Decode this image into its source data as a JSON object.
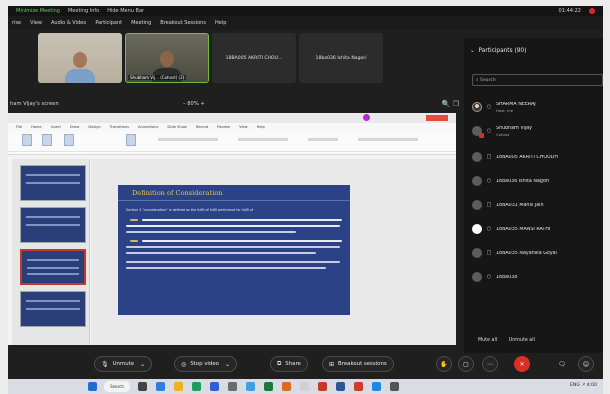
{
  "topbar": {
    "recording": "Minimize Meeting",
    "meeting_info": "Meeting Info",
    "hide_menu": "Hide Menu Bar",
    "time": "01:44:22"
  },
  "menubar": [
    "rise",
    "View",
    "Audio & Video",
    "Participant",
    "Meeting",
    "Breakout Sessions",
    "Help"
  ],
  "videos": [
    {
      "name": "",
      "type": "camera"
    },
    {
      "name": "Shubham Vij... (Cohost) (2)",
      "type": "camera"
    },
    {
      "name": "18BA005 AKRITI CHOU...",
      "type": "name"
    },
    {
      "name": "18ba036 Ishita Nagori",
      "type": "name"
    }
  ],
  "share": {
    "title": "ham Vijay's screen",
    "zoom": "–  80%  +"
  },
  "ppt": {
    "tabs": [
      "File",
      "Home",
      "Insert",
      "Draw",
      "Design",
      "Transitions",
      "Animations",
      "Slide Show",
      "Record",
      "Review",
      "View",
      "Help"
    ],
    "slide_title": "Definition of Consideration",
    "slide_intro": "Section 2 \"consideration\" is defined as the fulfil of fulfil performed for fulfil of"
  },
  "participants": {
    "header": "Participants (90)",
    "search_placeholder": "Search",
    "list": [
      {
        "name": "SHARMA NEERAJ",
        "sub": "Host, me",
        "icon": "○",
        "avatar": "img"
      },
      {
        "name": "Shubham Vijay",
        "sub": "Cohost",
        "icon": "○",
        "avatar": "badge"
      },
      {
        "name": "18BA005 AKRITI CHOUDH",
        "sub": "",
        "icon": "□",
        "avatar": "grey"
      },
      {
        "name": "18ba036 Ishita Nagori",
        "sub": "",
        "icon": "○",
        "avatar": "grey"
      },
      {
        "name": "18BA031 Mansi Jain",
        "sub": "",
        "icon": "□",
        "avatar": "grey"
      },
      {
        "name": "18BA035 MANSI RATHI",
        "sub": "",
        "icon": "○",
        "avatar": "white"
      },
      {
        "name": "18BA035 Nayanika Goyal",
        "sub": "",
        "icon": "□",
        "avatar": "grey"
      },
      {
        "name": "18ba038",
        "sub": "",
        "icon": "○",
        "avatar": "grey"
      }
    ],
    "mute_all": "Mute all",
    "unmute_all": "Unmute all"
  },
  "toolbar": {
    "unmute": "Unmute",
    "stop_video": "Stop video",
    "share": "Share",
    "breakout": "Breakout sessions"
  },
  "taskbar": {
    "search": "Search",
    "tray": "ENG ↗ 4:00"
  },
  "colors": {
    "slide_bg": "#2b4386",
    "slide_title": "#e9c25a",
    "end_button": "#d93025",
    "ppt_close": "#e64b3b"
  }
}
